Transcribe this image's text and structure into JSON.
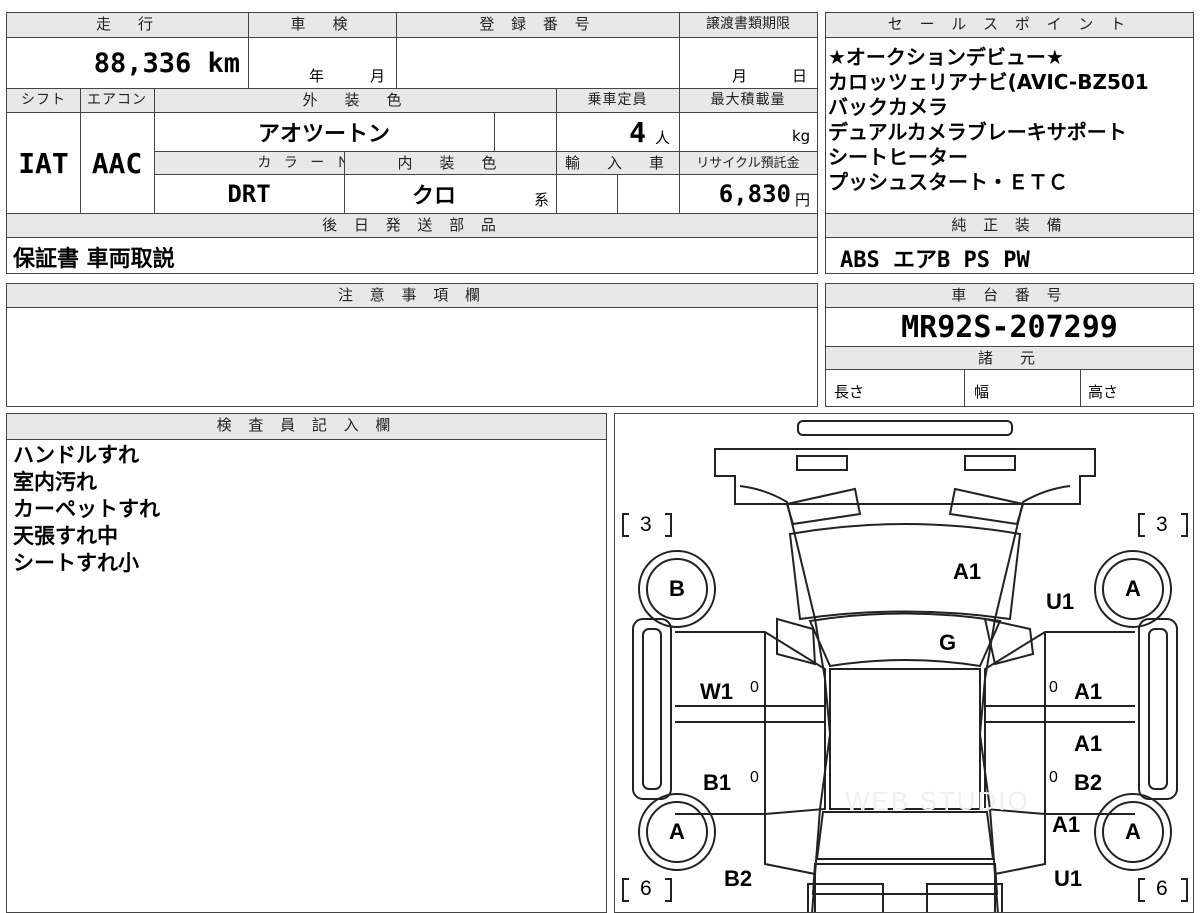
{
  "top": {
    "mileage": {
      "header": "走　行",
      "value": "88,336 km"
    },
    "inspection": {
      "header": "車　検",
      "year_label": "年",
      "month_label": "月"
    },
    "registration": {
      "header": "登 録 番 号"
    },
    "transfer_deadline": {
      "header": "譲渡書類期限",
      "month_label": "月",
      "day_label": "日"
    },
    "shift": {
      "header": "シフト",
      "value": "IAT"
    },
    "aircon": {
      "header": "エアコン",
      "value": "AAC"
    },
    "exterior_color": {
      "header": "外　装　色",
      "value": "アオツートン"
    },
    "capacity": {
      "header": "乗車定員",
      "value": "4",
      "unit": "人"
    },
    "max_load": {
      "header": "最大積載量",
      "unit": "kg"
    },
    "color_no": {
      "header": "カ ラ ー Ｎｏ．",
      "value": "DRT"
    },
    "interior_color": {
      "header": "内　装　色",
      "value": "クロ",
      "suffix": "系"
    },
    "import": {
      "header": "輸　入　車"
    },
    "recycle": {
      "header": "リサイクル預託金",
      "value": "6,830",
      "unit": "円"
    },
    "later_parts": {
      "header": "後 日 発 送 部 品",
      "value": "保証書 車両取説"
    }
  },
  "sales": {
    "header": "セ ー ル ス ポ イ ン ト",
    "lines": [
      "★オークションデビュー★",
      "カロッツェリアナビ(AVIC-BZ501",
      "バックカメラ",
      "デュアルカメラブレーキサポート",
      "シートヒーター",
      "プッシュスタート・ＥＴＣ"
    ]
  },
  "equipment": {
    "header": "純 正 装 備",
    "value": "ABS エアB PS PW"
  },
  "caution": {
    "header": "注 意 事 項 欄"
  },
  "chassis": {
    "header": "車 台 番 号",
    "value": "MR92S-207299"
  },
  "specs": {
    "header": "諸　元",
    "length": "長さ",
    "width": "幅",
    "height": "高さ"
  },
  "inspector": {
    "header": "検 査 員 記 入 欄",
    "lines": [
      "ハンドルすれ",
      "室内汚れ",
      "カーペットすれ",
      "天張すれ中",
      "シートすれ小"
    ]
  },
  "diagram": {
    "tire_front_left": "3",
    "tire_front_right": "3",
    "tire_rear_left": "6",
    "tire_rear_right": "6",
    "wheel_fl": "B",
    "wheel_fr": "A",
    "wheel_rl": "A",
    "wheel_rr": "A",
    "marks": {
      "hood": "A1",
      "front_fender_r": "U1",
      "windshield": "G",
      "front_door_l": "W1",
      "front_door_r": "A1",
      "rear_door_r_top": "A1",
      "rear_door_l": "B1",
      "rear_door_r": "B2",
      "rear_fender_r": "A1",
      "rear_quarter_l": "B2",
      "rear_quarter_r": "U1"
    },
    "zero": "0",
    "watermark": "WEB STUDIO"
  }
}
